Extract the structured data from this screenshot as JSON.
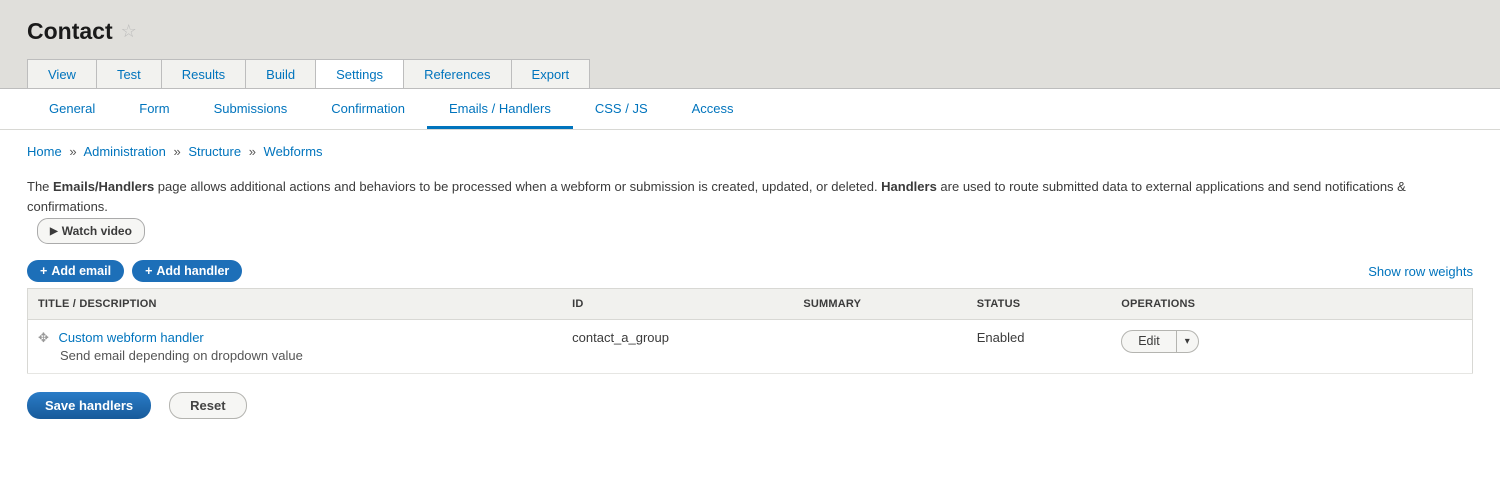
{
  "page": {
    "title": "Contact"
  },
  "primary_tabs": [
    {
      "label": "View"
    },
    {
      "label": "Test"
    },
    {
      "label": "Results"
    },
    {
      "label": "Build"
    },
    {
      "label": "Settings",
      "active": true
    },
    {
      "label": "References"
    },
    {
      "label": "Export"
    }
  ],
  "secondary_tabs": [
    {
      "label": "General"
    },
    {
      "label": "Form"
    },
    {
      "label": "Submissions"
    },
    {
      "label": "Confirmation"
    },
    {
      "label": "Emails / Handlers",
      "active": true
    },
    {
      "label": "CSS / JS"
    },
    {
      "label": "Access"
    }
  ],
  "breadcrumb": [
    {
      "label": "Home"
    },
    {
      "label": "Administration"
    },
    {
      "label": "Structure"
    },
    {
      "label": "Webforms"
    }
  ],
  "description": {
    "prefix": "The ",
    "strong1": "Emails/Handlers",
    "mid": " page allows additional actions and behaviors to be processed when a webform or submission is created, updated, or deleted. ",
    "strong2": "Handlers",
    "suffix": " are used to route submitted data to external applications and send notifications & confirmations."
  },
  "watch_video_label": "Watch video",
  "buttons": {
    "add_email": "Add email",
    "add_handler": "Add handler",
    "save": "Save handlers",
    "reset": "Reset"
  },
  "show_row_weights_label": "Show row weights",
  "table": {
    "columns": {
      "title": "TITLE / DESCRIPTION",
      "id": "ID",
      "summary": "SUMMARY",
      "status": "STATUS",
      "operations": "OPERATIONS"
    },
    "rows": [
      {
        "title": "Custom webform handler",
        "description": "Send email depending on dropdown value",
        "id": "contact_a_group",
        "summary": "",
        "status": "Enabled",
        "op_main": "Edit"
      }
    ]
  }
}
